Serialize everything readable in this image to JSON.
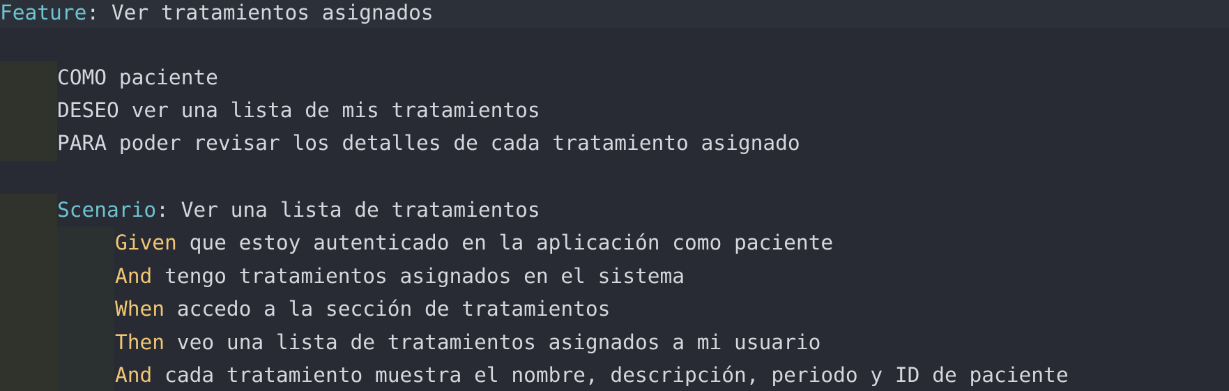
{
  "feature": {
    "keyword": "Feature",
    "separator": ":",
    "title": " Ver tratamientos asignados"
  },
  "description": [
    "COMO paciente",
    "DESEO ver una lista de mis tratamientos",
    "PARA poder revisar los detalles de cada tratamiento asignado"
  ],
  "scenario": {
    "keyword": "Scenario",
    "separator": ":",
    "title": " Ver una lista de tratamientos",
    "steps": [
      {
        "keyword": "Given",
        "text": " que estoy autenticado en la aplicación como paciente"
      },
      {
        "keyword": "And",
        "text": " tengo tratamientos asignados en el sistema"
      },
      {
        "keyword": "When",
        "text": " accedo a la sección de tratamientos"
      },
      {
        "keyword": "Then",
        "text": " veo una lista de tratamientos asignados a mi usuario"
      },
      {
        "keyword": "And",
        "text": " cada tratamiento muestra el nombre, descripción, periodo y ID de paciente"
      }
    ]
  },
  "colors": {
    "background": "#282b33",
    "keyword_structure": "#6fc2cf",
    "keyword_step": "#f0c674",
    "text": "#d4d7dd"
  }
}
